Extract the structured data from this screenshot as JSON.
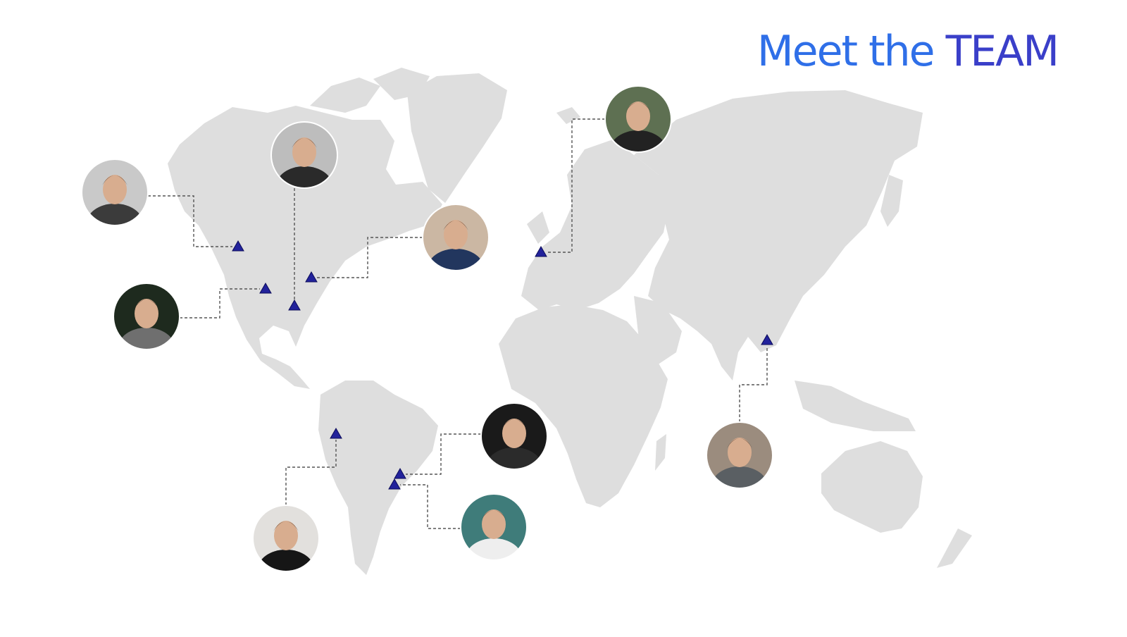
{
  "title": {
    "part1": "Meet the ",
    "part2": "TEAM"
  },
  "colors": {
    "land": "#dedede",
    "marker": "#22229b",
    "connector": "#555555",
    "title_primary": "#2f6fe8",
    "title_accent": "#3a3fc9"
  },
  "team": [
    {
      "member": "member-1",
      "avatar_tone": "#c9c9c9",
      "shirt_tone": "#3b3b3b"
    },
    {
      "member": "member-2",
      "avatar_tone": "#bdbdbd",
      "shirt_tone": "#2a2a2a"
    },
    {
      "member": "member-3",
      "avatar_tone": "#1e2a1e",
      "shirt_tone": "#6f6f6f"
    },
    {
      "member": "member-4",
      "avatar_tone": "#cbb7a3",
      "shirt_tone": "#22365e"
    },
    {
      "member": "member-5",
      "avatar_tone": "#5e7052",
      "shirt_tone": "#222222"
    },
    {
      "member": "member-6",
      "avatar_tone": "#1a1a1a",
      "shirt_tone": "#2b2b2b"
    },
    {
      "member": "member-7",
      "avatar_tone": "#9b8c7e",
      "shirt_tone": "#5a5f63"
    },
    {
      "member": "member-8",
      "avatar_tone": "#e2e0dd",
      "shirt_tone": "#161616"
    },
    {
      "member": "member-9",
      "avatar_tone": "#3f7c7a",
      "shirt_tone": "#eeeeee"
    }
  ]
}
